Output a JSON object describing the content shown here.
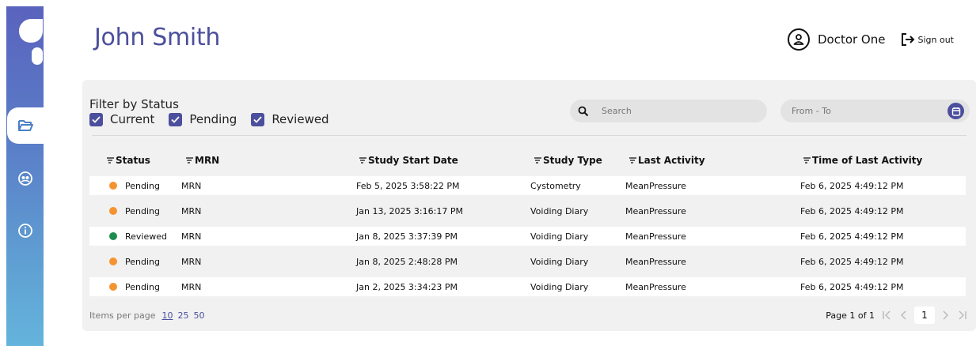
{
  "header": {
    "title": "John Smith",
    "user_name": "Doctor One",
    "signout_label": "Sign out"
  },
  "filters": {
    "label": "Filter by Status",
    "options": [
      {
        "label": "Current",
        "checked": true
      },
      {
        "label": "Pending",
        "checked": true
      },
      {
        "label": "Reviewed",
        "checked": true
      }
    ],
    "search_placeholder": "Search",
    "date_placeholder": "From - To"
  },
  "table": {
    "columns": [
      "Status",
      "MRN",
      "Study Start Date",
      "Study Type",
      "Last Activity",
      "Time of Last Activity"
    ],
    "rows": [
      {
        "status": "Pending",
        "status_color": "#f59331",
        "mrn": "MRN",
        "start": "Feb 5, 2025 3:58:22 PM",
        "type": "Cystometry",
        "activity": "MeanPressure",
        "time": "Feb 6, 2025 4:49:12 PM"
      },
      {
        "status": "Pending",
        "status_color": "#f59331",
        "mrn": "MRN",
        "start": "Jan 13, 2025 3:16:17 PM",
        "type": "Voiding Diary",
        "activity": "MeanPressure",
        "time": "Feb 6, 2025 4:49:12 PM"
      },
      {
        "status": "Reviewed",
        "status_color": "#1e8c4e",
        "mrn": "MRN",
        "start": "Jan 8, 2025 3:37:39 PM",
        "type": "Voiding Diary",
        "activity": "MeanPressure",
        "time": "Feb 6, 2025 4:49:12 PM"
      },
      {
        "status": "Pending",
        "status_color": "#f59331",
        "mrn": "MRN",
        "start": "Jan 8, 2025 2:48:28 PM",
        "type": "Voiding Diary",
        "activity": "MeanPressure",
        "time": "Feb 6, 2025 4:49:12 PM"
      },
      {
        "status": "Pending",
        "status_color": "#f59331",
        "mrn": "MRN",
        "start": "Jan 2, 2025 3:34:23 PM",
        "type": "Voiding Diary",
        "activity": "MeanPressure",
        "time": "Feb 6, 2025 4:49:12 PM"
      }
    ]
  },
  "footer": {
    "items_per_page_label": "Items per page",
    "page_size_options": [
      "10",
      "25",
      "50"
    ],
    "page_info": "Page 1 of 1",
    "current_page": "1"
  },
  "colors": {
    "accent": "#4b4f9d",
    "title": "#4c4f9c",
    "sidebar_top": "#5a63bd",
    "sidebar_bottom": "#64b4dc"
  },
  "icons": {
    "nav": [
      "folder-icon",
      "people-icon",
      "info-icon"
    ],
    "header": [
      "user-icon",
      "sign-out-icon"
    ],
    "controls": [
      "search-icon",
      "calendar-icon",
      "sort-icon"
    ]
  }
}
